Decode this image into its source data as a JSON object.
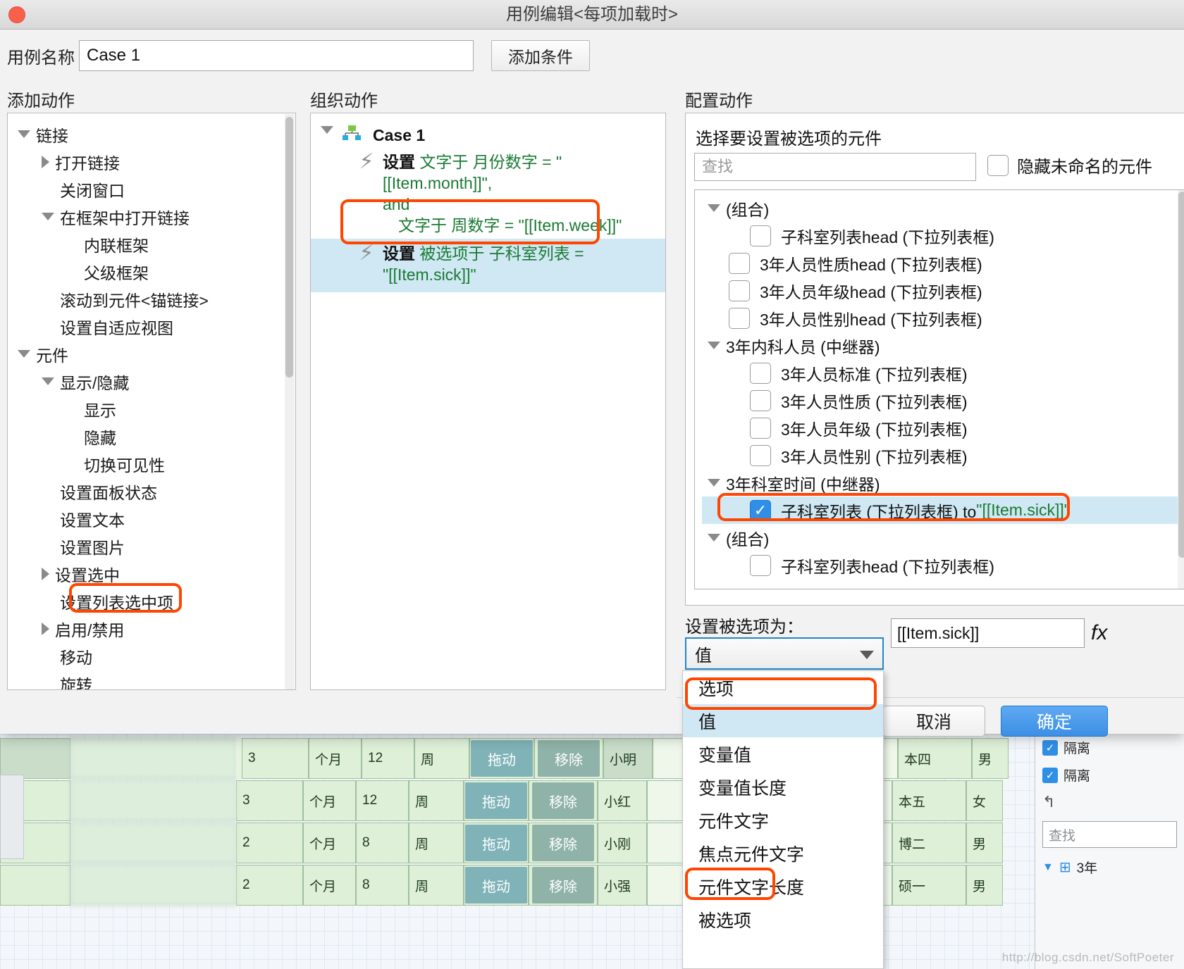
{
  "window": {
    "title": "用例编辑<每项加载时>",
    "close_icon": "close-traffic-light"
  },
  "case_name": {
    "label": "用例名称",
    "value": "Case 1"
  },
  "add_condition_button": "添加条件",
  "columns": {
    "add_action": "添加动作",
    "organize_action": "组织动作",
    "configure_action": "配置动作"
  },
  "action_tree": {
    "items": [
      {
        "label": "链接",
        "indent": 0,
        "twisty": "down"
      },
      {
        "label": "打开链接",
        "indent": 1,
        "twisty": "right"
      },
      {
        "label": "关闭窗口",
        "indent": 1,
        "twisty": "none"
      },
      {
        "label": "在框架中打开链接",
        "indent": 1,
        "twisty": "down"
      },
      {
        "label": "内联框架",
        "indent": 2,
        "twisty": "none"
      },
      {
        "label": "父级框架",
        "indent": 2,
        "twisty": "none"
      },
      {
        "label": "滚动到元件<锚链接>",
        "indent": 1,
        "twisty": "none"
      },
      {
        "label": "设置自适应视图",
        "indent": 1,
        "twisty": "none"
      },
      {
        "label": "元件",
        "indent": 0,
        "twisty": "down"
      },
      {
        "label": "显示/隐藏",
        "indent": 1,
        "twisty": "down"
      },
      {
        "label": "显示",
        "indent": 2,
        "twisty": "none"
      },
      {
        "label": "隐藏",
        "indent": 2,
        "twisty": "none"
      },
      {
        "label": "切换可见性",
        "indent": 2,
        "twisty": "none"
      },
      {
        "label": "设置面板状态",
        "indent": 1,
        "twisty": "none"
      },
      {
        "label": "设置文本",
        "indent": 1,
        "twisty": "none"
      },
      {
        "label": "设置图片",
        "indent": 1,
        "twisty": "none"
      },
      {
        "label": "设置选中",
        "indent": 1,
        "twisty": "right"
      },
      {
        "label": "设置列表选中项",
        "indent": 1,
        "twisty": "none",
        "highlighted": true
      },
      {
        "label": "启用/禁用",
        "indent": 1,
        "twisty": "right"
      },
      {
        "label": "移动",
        "indent": 1,
        "twisty": "none"
      },
      {
        "label": "旋转",
        "indent": 1,
        "twisty": "none"
      }
    ]
  },
  "organize": {
    "case_label": "Case 1",
    "case_icon": "sitemap-icon",
    "actions": [
      {
        "icon": "lightning-bolt-icon",
        "line1_key": "设置",
        "line1_rest": "文字于 月份数字 = \"[[Item.month]]\",",
        "line2": "and",
        "line3": "文字于 周数字 = \"[[Item.week]]\"",
        "selected": false
      },
      {
        "icon": "lightning-bolt-icon",
        "line1_key": "设置",
        "line1_rest": "被选项于 子科室列表 =",
        "line2": "\"[[Item.sick]]\"",
        "selected": true,
        "highlighted": true
      }
    ]
  },
  "configure": {
    "prompt": "选择要设置被选项的元件",
    "search_placeholder": "查找",
    "hide_unnamed_label": "隐藏未命名的元件",
    "hide_unnamed_checked": false,
    "tree": [
      {
        "label": "(组合)",
        "indent": 0,
        "type": "group",
        "twisty": "down"
      },
      {
        "label": "子科室列表head (下拉列表框)",
        "indent": 2,
        "type": "checkbox",
        "checked": false
      },
      {
        "label": "3年人员性质head (下拉列表框)",
        "indent": 1,
        "type": "checkbox",
        "checked": false
      },
      {
        "label": "3年人员年级head (下拉列表框)",
        "indent": 1,
        "type": "checkbox",
        "checked": false
      },
      {
        "label": "3年人员性别head (下拉列表框)",
        "indent": 1,
        "type": "checkbox",
        "checked": false
      },
      {
        "label": "3年内科人员 (中继器)",
        "indent": 0,
        "type": "group",
        "twisty": "down"
      },
      {
        "label": "3年人员标准 (下拉列表框)",
        "indent": 2,
        "type": "checkbox",
        "checked": false
      },
      {
        "label": "3年人员性质 (下拉列表框)",
        "indent": 2,
        "type": "checkbox",
        "checked": false
      },
      {
        "label": "3年人员年级 (下拉列表框)",
        "indent": 2,
        "type": "checkbox",
        "checked": false
      },
      {
        "label": "3年人员性别 (下拉列表框)",
        "indent": 2,
        "type": "checkbox",
        "checked": false
      },
      {
        "label": "3年科室时间 (中继器)",
        "indent": 0,
        "type": "group",
        "twisty": "down"
      },
      {
        "label": "子科室列表 (下拉列表框) to ",
        "suffix": "\"[[Item.sick]]\"",
        "indent": 2,
        "type": "checkbox",
        "checked": true,
        "selected": true,
        "highlighted": true
      },
      {
        "label": "(组合)",
        "indent": 0,
        "type": "group",
        "twisty": "down"
      },
      {
        "label": "子科室列表head (下拉列表框)",
        "indent": 2,
        "type": "checkbox",
        "checked": false
      }
    ]
  },
  "set_selected": {
    "label": "设置被选项为：",
    "combo_value": "值",
    "combo_caret_icon": "chevron-down-icon",
    "value_field": "[[Item.sick]]",
    "fx_label": "fx",
    "options": [
      "选项",
      "值",
      "变量值",
      "变量值长度",
      "元件文字",
      "焦点元件文字",
      "元件文字长度",
      "被选项"
    ],
    "selected_option": "值",
    "highlighted_options": [
      "值",
      "被选项"
    ]
  },
  "footer": {
    "cancel": "取消",
    "ok": "确定"
  },
  "background": {
    "rows": [
      {
        "name": "小明",
        "num": "3",
        "unit": "个月",
        "count": "12",
        "period": "周",
        "drag": "拖动",
        "remove": "移除",
        "edu": "本四",
        "gender": "男"
      },
      {
        "name": "小红",
        "num": "3",
        "unit": "个月",
        "count": "12",
        "period": "周",
        "drag": "拖动",
        "remove": "移除",
        "edu": "本五",
        "gender": "女"
      },
      {
        "name": "小刚",
        "num": "2",
        "unit": "个月",
        "count": "8",
        "period": "周",
        "drag": "拖动",
        "remove": "移除",
        "edu": "博二",
        "gender": "男"
      },
      {
        "name": "小强",
        "num": "2",
        "unit": "个月",
        "count": "8",
        "period": "周",
        "drag": "拖动",
        "remove": "移除",
        "edu": "硕一",
        "gender": "男"
      }
    ],
    "right_panel": {
      "row1": "隔离",
      "row2": "隔离",
      "search_placeholder": "查找",
      "tree_label": "3年"
    },
    "watermark": "http://blog.csdn.net/SoftPoeter"
  },
  "colors": {
    "annotation": "#ff4500",
    "selection": "#cfe8f3",
    "accent_blue": "#3b8fe5",
    "green_text": "#1a7a33"
  }
}
